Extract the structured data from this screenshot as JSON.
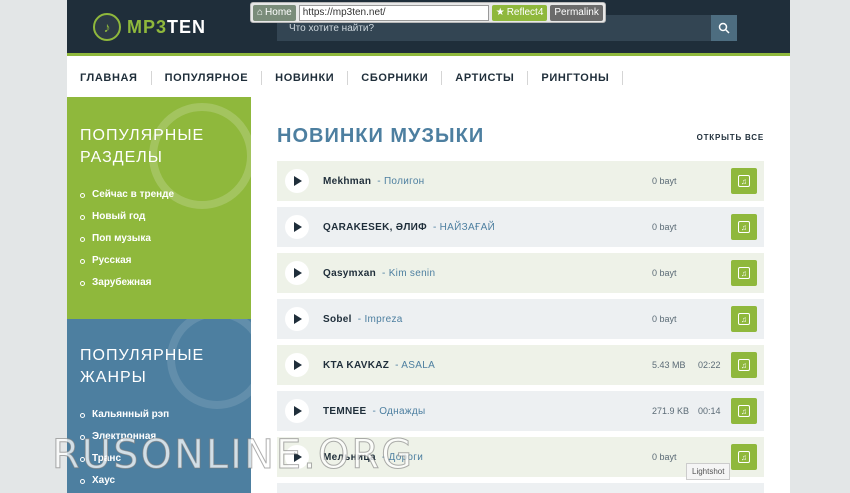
{
  "browser_toolbar": {
    "home_label": "Home",
    "url": "https://mp3ten.net/",
    "reflect_label": "Reflect4",
    "permalink_label": "Permalink"
  },
  "header": {
    "logo_text_1": "MP3",
    "logo_text_2": "TEN",
    "search_placeholder": "Что хотите найти?"
  },
  "nav": {
    "items": [
      "ГЛАВНАЯ",
      "ПОПУЛЯРНОЕ",
      "НОВИНКИ",
      "СБОРНИКИ",
      "АРТИСТЫ",
      "РИНГТОНЫ"
    ]
  },
  "sidebar": {
    "sections_title_1": "ПОПУЛЯРНЫЕ",
    "sections_title_2": "РАЗДЕЛЫ",
    "sections": [
      "Сейчас в тренде",
      "Новый год",
      "Поп музыка",
      "Русская",
      "Зарубежная"
    ],
    "genres_title_1": "ПОПУЛЯРНЫЕ",
    "genres_title_2": "ЖАНРЫ",
    "genres": [
      "Кальянный рэп",
      "Электронная",
      "Транс",
      "Хаус"
    ]
  },
  "main": {
    "title": "НОВИНКИ МУЗЫКИ",
    "open_all": "ОТКРЫТЬ ВСЕ",
    "tracks": [
      {
        "artist": "Mekhman",
        "song": "- Полигон",
        "size": "0 bayt",
        "duration": ""
      },
      {
        "artist": "QARAKESEK, ӘЛИФ",
        "song": "- НАЙЗАҒАЙ",
        "size": "0 bayt",
        "duration": ""
      },
      {
        "artist": "Qasymxan",
        "song": "- Kim senin",
        "size": "0 bayt",
        "duration": ""
      },
      {
        "artist": "Sobel",
        "song": "- Impreza",
        "size": "0 bayt",
        "duration": ""
      },
      {
        "artist": "KTA KAVKAZ",
        "song": "- ASALA",
        "size": "5.43 MB",
        "duration": "02:22"
      },
      {
        "artist": "TEMNEE",
        "song": "- Однажды",
        "size": "271.9 KB",
        "duration": "00:14"
      },
      {
        "artist": "Мельница",
        "song": "- Дороги",
        "size": "0 bayt",
        "duration": ""
      }
    ]
  },
  "overlay": {
    "lightshot": "Lightshot",
    "watermark": "RUSONLINE.ORG"
  },
  "colors": {
    "green": "#8fb83c",
    "dark": "#1f2e3a",
    "blue": "#4d7fa0"
  }
}
